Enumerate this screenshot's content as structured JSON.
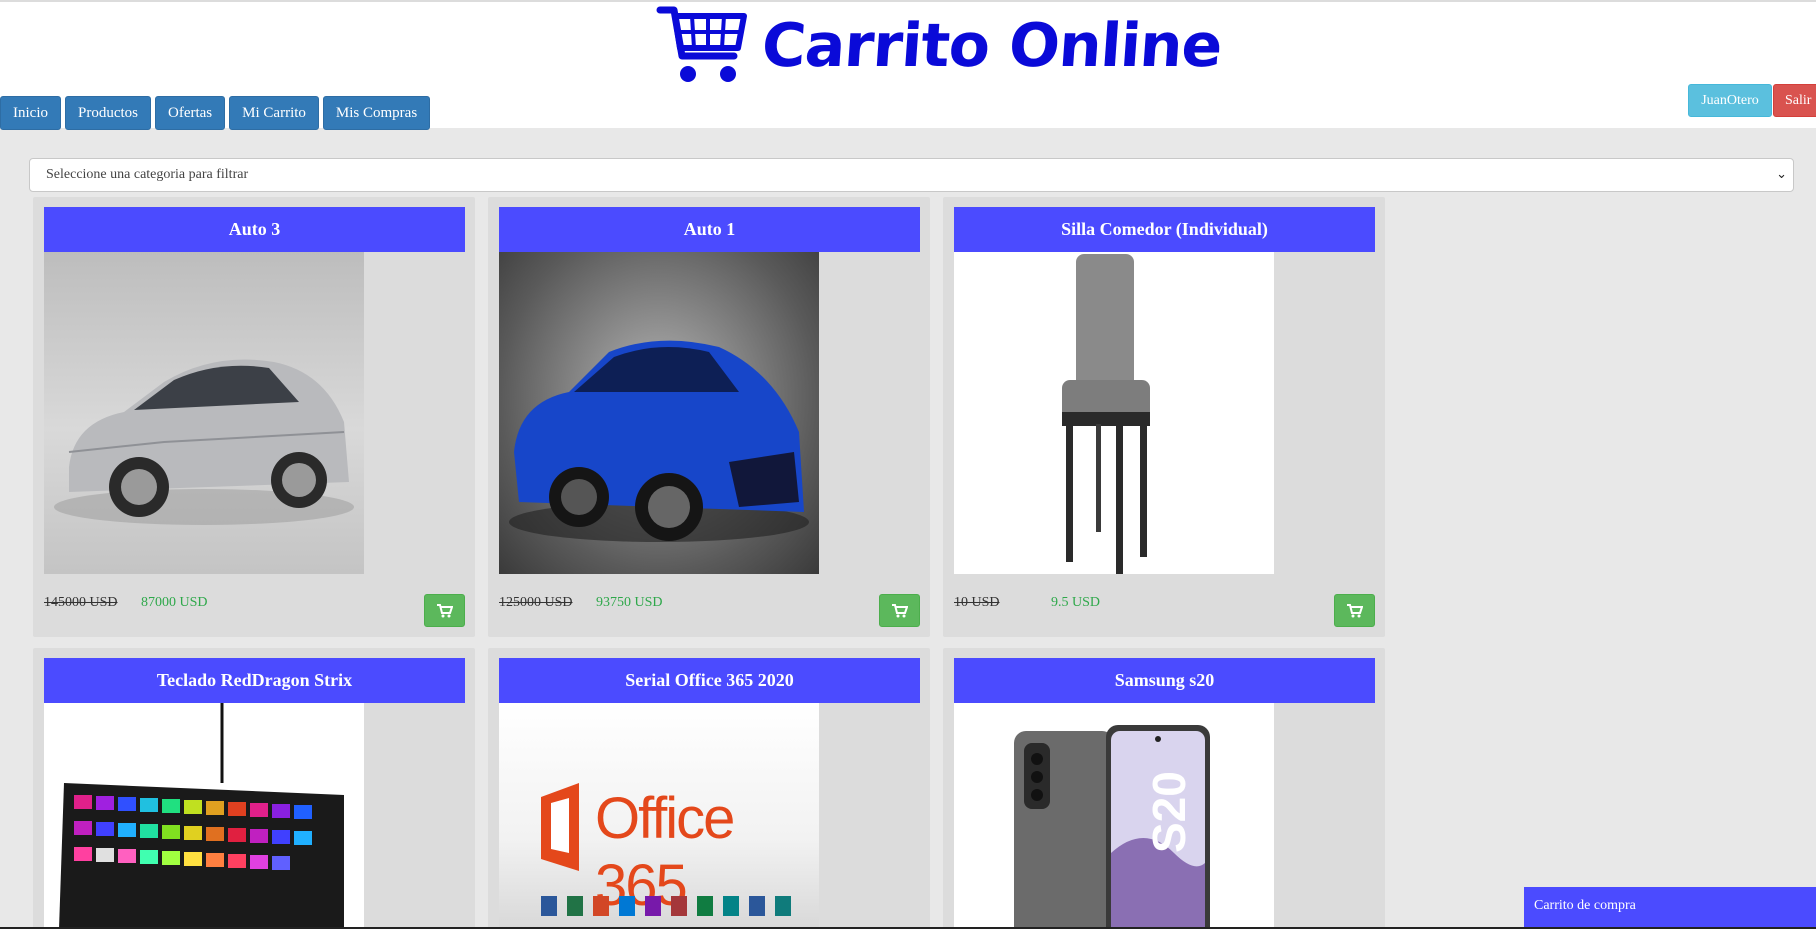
{
  "brand": {
    "title": "Carrito Online",
    "icon": "shopping-cart-icon",
    "color": "#0a0ad8"
  },
  "nav": {
    "items": [
      {
        "label": "Inicio"
      },
      {
        "label": "Productos"
      },
      {
        "label": "Ofertas"
      },
      {
        "label": "Mi Carrito"
      },
      {
        "label": "Mis Compras"
      }
    ]
  },
  "user": {
    "name": "JuanOtero",
    "logout_label": "Salir"
  },
  "filter": {
    "placeholder": "Seleccione una categoria para filtrar"
  },
  "products": [
    {
      "title": "Auto 3",
      "old_price": "145000 USD",
      "new_price": "87000 USD",
      "image": "silver-car"
    },
    {
      "title": "Auto 1",
      "old_price": "125000 USD",
      "new_price": "93750 USD",
      "image": "blue-car"
    },
    {
      "title": "Silla Comedor (Individual)",
      "old_price": "10 USD",
      "new_price": "9.5 USD",
      "image": "chair"
    },
    {
      "title": "Teclado RedDragon Strix",
      "image": "keyboard"
    },
    {
      "title": "Serial Office 365 2020",
      "image": "office-logo",
      "image_text": "Office 365"
    },
    {
      "title": "Samsung s20",
      "image": "phone",
      "image_text": "S20"
    }
  ],
  "cart_panel": {
    "label": "Carrito de compra"
  },
  "colors": {
    "header_bar": "#4b4bff",
    "nav": "#337ab7",
    "cart_button": "#5cb85c",
    "new_price": "#2ea84a"
  }
}
